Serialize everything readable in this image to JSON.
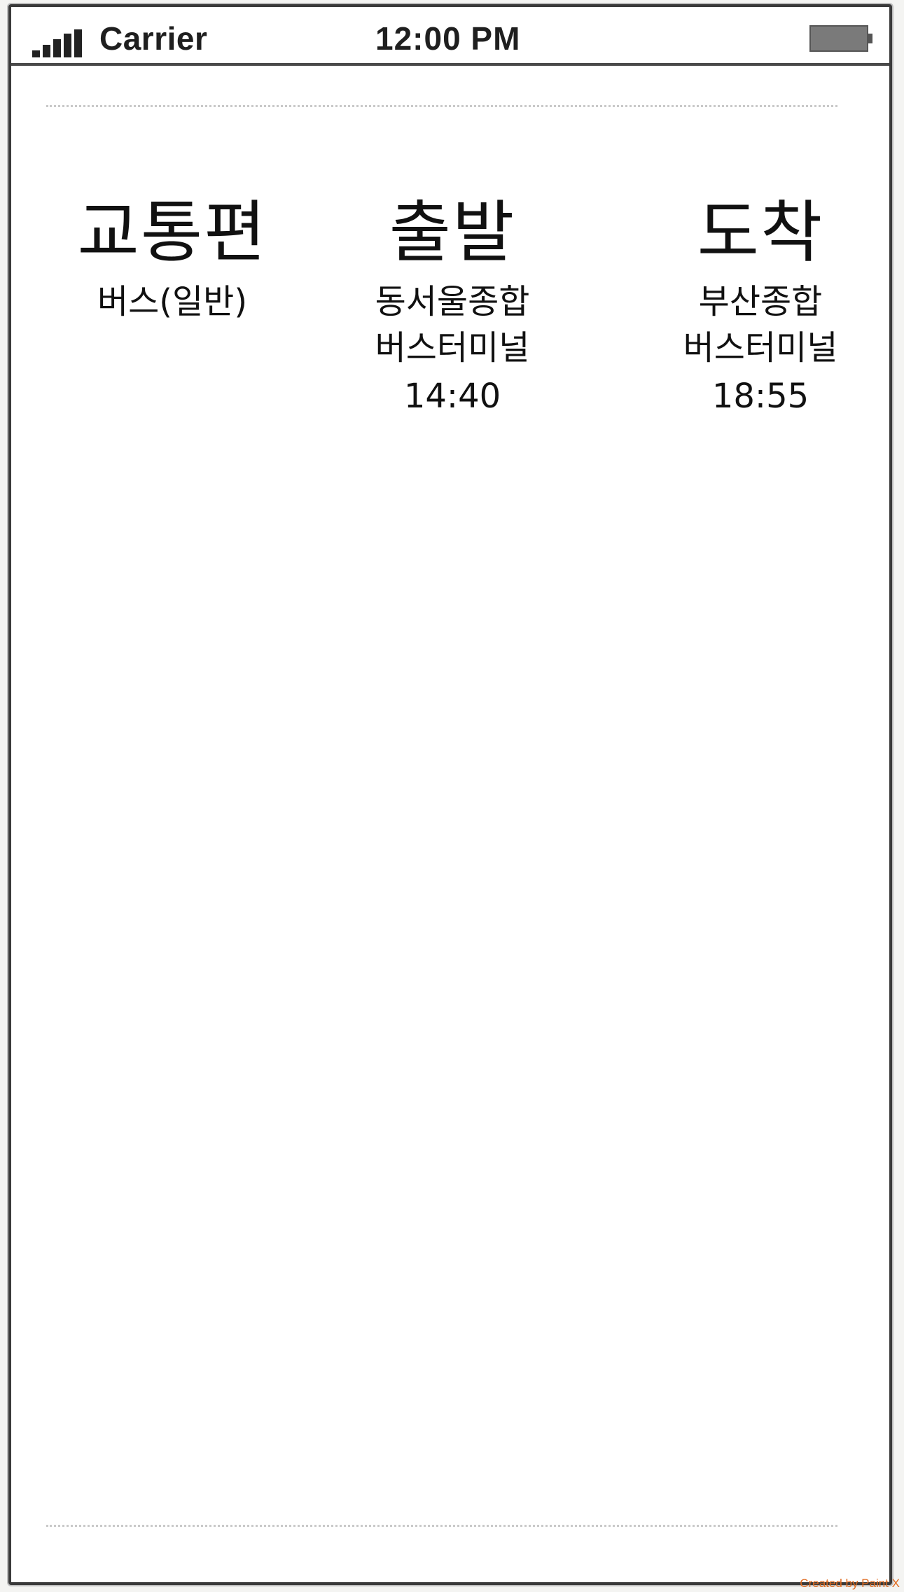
{
  "statusbar": {
    "carrier": "Carrier",
    "time": "12:00 PM",
    "signal_icon": "signal-bars-icon",
    "battery_icon": "battery-icon"
  },
  "columns": {
    "transport": {
      "title": "교통편",
      "value": "버스(일반)"
    },
    "departure": {
      "title": "출발",
      "line1": "동서울종합",
      "line2": "버스터미널",
      "time": "14:40"
    },
    "arrival": {
      "title": "도착",
      "line1": "부산종합",
      "line2": "버스터미널",
      "time": "18:55"
    }
  },
  "watermark": "Created by Paint X",
  "colors": {
    "frame": "#3a3a3a",
    "text": "#111111",
    "watermark": "#e06a1e"
  }
}
